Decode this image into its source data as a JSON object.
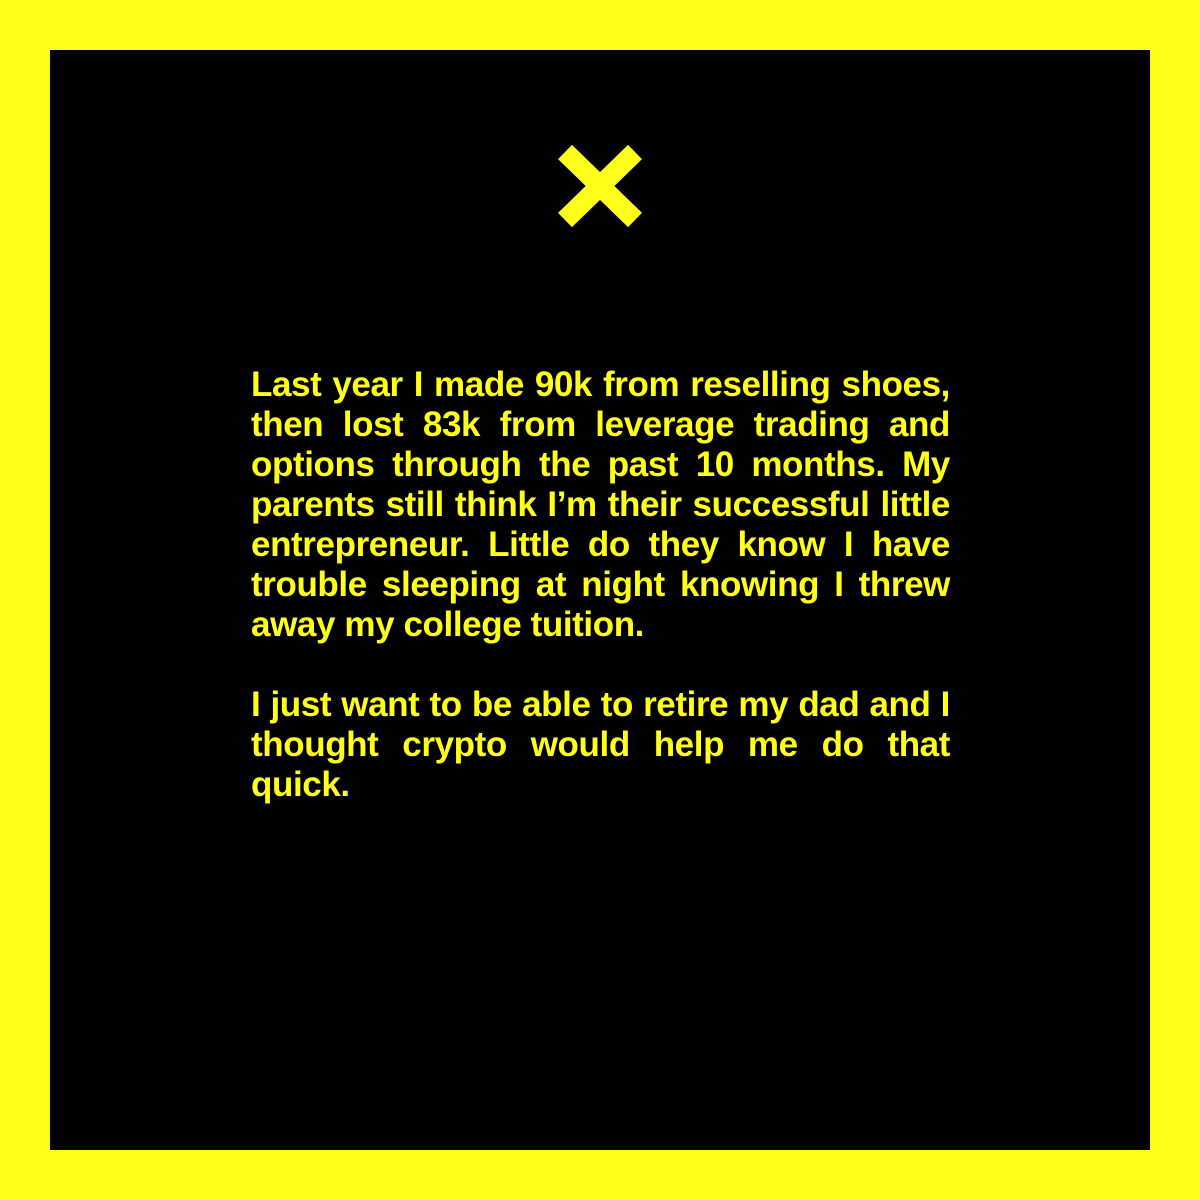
{
  "colors": {
    "frame": "#FFFF1A",
    "panel": "#000000",
    "text": "#FFFF1A"
  },
  "icon": {
    "name": "x-icon"
  },
  "story": {
    "paragraph_1": "Last year I made 90k from reselling shoes, then lost 83k from leverage trading and options through the past 10 months. My parents still think I’m their successful little entrepreneur. Little do they know I have trouble sleeping at night knowing I threw away my college tuition.",
    "paragraph_2": "I just want to be able to retire my dad and I thought crypto would help me do that quick."
  }
}
